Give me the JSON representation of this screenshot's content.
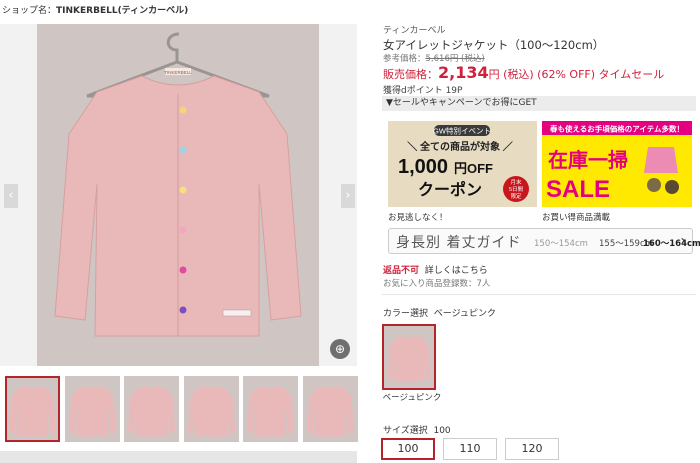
{
  "shop": {
    "label": "ショップ名：",
    "name": "TINKERBELL(ティンカーベル)"
  },
  "gallery": {
    "prev": "‹",
    "next": "›",
    "zoom": "⊕",
    "photo_tag": "TINKERBELL",
    "thumbnails": [
      "thumb-1",
      "thumb-2",
      "thumb-3",
      "thumb-4",
      "thumb-5",
      "thumb-6"
    ],
    "selected_index": 0
  },
  "product": {
    "brand": "ティンカーベル",
    "title": "女アイレットジャケット（100〜120cm）",
    "ref_label": "参考価格：",
    "ref_price": "5,616円 (税込)",
    "sale_label": "販売価格：",
    "price": "2,134",
    "price_suffix": "円 (税込) (62% OFF) タイムセール",
    "points": "獲得dポイント 19P"
  },
  "campaign": {
    "toggle": "▼セールやキャンペーンでお得にGET"
  },
  "banner1": {
    "tag": "GW特別イベント",
    "line1": "＼ 全ての商品が対象 ／",
    "amount": "1,000",
    "unit": "円OFF",
    "coupon": "クーポン",
    "badge": [
      "月末",
      "5日間",
      "限定"
    ],
    "caption": "お見逃しなく！"
  },
  "banner2": {
    "top": "春も使えるお手頃価格のアイテム多数！",
    "title": "在庫一掃",
    "sale": "SALE",
    "caption": "お買い得商品満載"
  },
  "size_guide": {
    "label": "身長別 着丈ガイド",
    "opt1": "150〜154cm",
    "opt2": "155〜159cm",
    "opt3": "160〜164cm",
    "chevron": "›"
  },
  "returns": {
    "label": "返品不可",
    "link": "詳しくはこちら"
  },
  "favorites": "お気に入り商品登録数：7人",
  "color": {
    "label": "カラー選択",
    "value": "ベージュピンク",
    "swatch_name": "ベージュピンク"
  },
  "size": {
    "label": "サイズ選択",
    "value": "100",
    "options": [
      "100",
      "110",
      "120"
    ],
    "selected": "100"
  },
  "colors": {
    "accent": "#b5242b",
    "price": "#d0203a",
    "garment": "#e9b9b9",
    "photo_bg": "#cfc6c4",
    "banner_yellow": "#ffe900"
  },
  "icons": [
    "chevron-left-icon",
    "chevron-right-icon",
    "zoom-icon",
    "chevron-right-icon"
  ]
}
